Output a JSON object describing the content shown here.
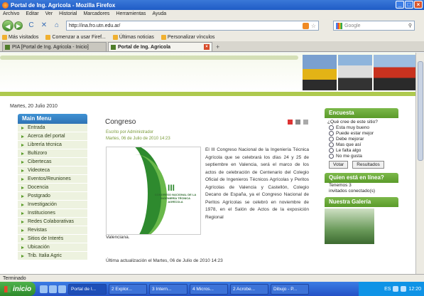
{
  "window": {
    "title": "Portal de Ing. Agricola - Mozilla Firefox",
    "buttons": [
      "_",
      "□",
      "×"
    ]
  },
  "menu": [
    "Archivo",
    "Editar",
    "Ver",
    "Historial",
    "Marcadores",
    "Herramientas",
    "Ayuda"
  ],
  "nav": {
    "back": "◀",
    "forward": "▶",
    "reload": "C",
    "stop": "✕",
    "home": "⌂",
    "url": "http://ina.fro.utn.edu.ar/",
    "search_placeholder": "Google",
    "star": "☆",
    "search_btn": "⚲"
  },
  "bookmarks": [
    "Más visitados",
    "Comenzar a usar Firef...",
    "Últimas noticias",
    "Personalizar vínculos"
  ],
  "tabs": [
    {
      "label": "PIA [Portal de Ing. Agricola - Inicio]"
    },
    {
      "label": "Portal de Ing. Agricola",
      "close": "×"
    }
  ],
  "tab_add": "+",
  "page": {
    "date": "Martes, 20 Julio 2010",
    "main_menu": {
      "title": "Main Menu",
      "items": [
        "Entrada",
        "Acerca del portal",
        "Librería técnica",
        "Bultizoro",
        "Cibertecas",
        "Videoteca",
        "Eventos/Reuniones",
        "Docencia",
        "Postgrado",
        "Investigación",
        "Instituciones",
        "Redes Colaborativas",
        "Revistas",
        "Sitios de Interés",
        "Ubicación",
        "Trib. Italia Agric"
      ]
    },
    "article": {
      "title": "Congreso",
      "author": "Escrito por Administrador",
      "date": "Martes, 06 de Julio de 2010 14:23",
      "poster_num": "III",
      "poster_text": "CONGRESO NACIONAL DE LA INGENIERÍA TÉCNICA AGRÍCOLA",
      "body": "El III Congreso Nacional de la Ingeniería Técnica Agrícola que se celebrará los días 24 y 25 de septiembre en Valencia, será el marco de los actos de celebración de Centenario del Colegio Oficial de Ingenieros Técnicos Agrícolas y Peritos Agrícolas de Valencia y Castellón, Colegio Decano de España, ya el Congreso Nacional de Peritos Agrícolas se celebró en noviembre de 1978, en el Salón de Actos de la exposición Regional",
      "body_end": "Valenciana.",
      "updated": "Última actualización el Martes, 06 de Julio de 2010 14:23"
    },
    "poll": {
      "title": "Encuesta",
      "question": "¿Qué cree de este sitio?",
      "options": [
        "Esta muy bueno",
        "Puede estar mejor",
        "Debe mejorar",
        "Mas que así",
        "Le falta algo",
        "No me gusta"
      ],
      "vote_btn": "Votar",
      "results_btn": "Resultados"
    },
    "online": {
      "title": "Quien está en línea?",
      "line1": "Tenemos 3",
      "line2": "invitados conectado(s)"
    },
    "gallery": {
      "title": "Nuestra Galería"
    }
  },
  "status": "Terminado",
  "taskbar": {
    "start": "inicio",
    "tasks": [
      "Portal de I...",
      "2 Explor...",
      "3 Intern...",
      "4 Micros...",
      "2 Acrobe...",
      "Dibujo - P..."
    ],
    "clock": "12:20",
    "lang": "ES"
  },
  "colors": {
    "accent_green": "#5a9b2a",
    "menu_blue": "#2f73b4",
    "title_blue": "#1f5cc6"
  }
}
